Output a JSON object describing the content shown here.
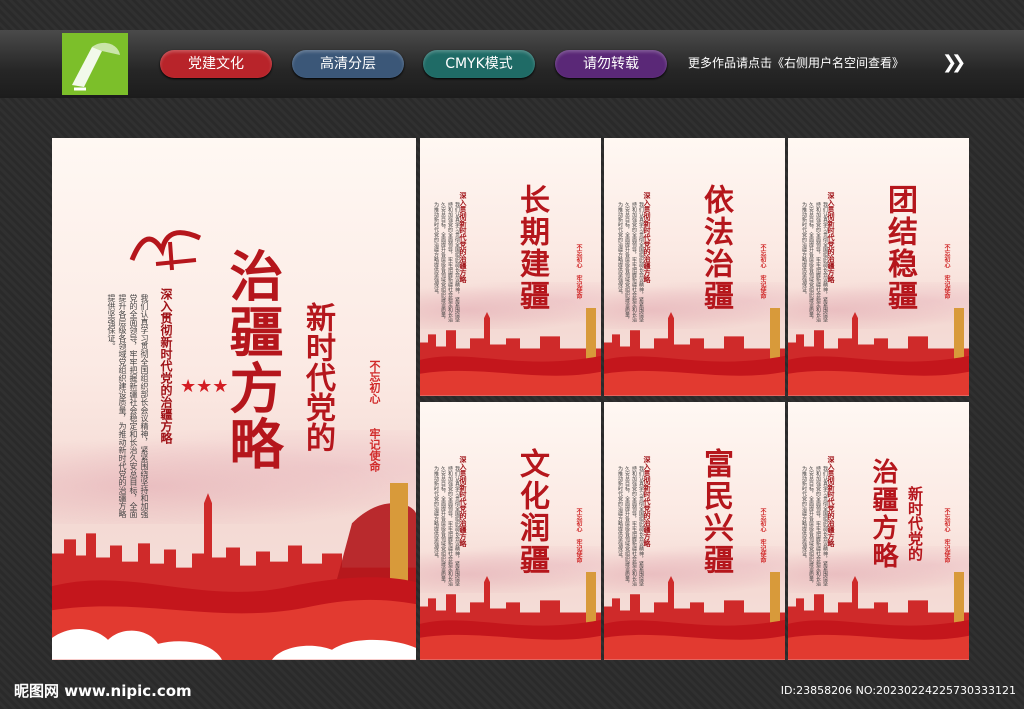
{
  "header": {
    "tags": [
      "党建文化",
      "高清分层",
      "CMYK模式",
      "请勿转载"
    ],
    "more_text": "更多作品请点击《右侧用户名空间查看》",
    "arrow_icon": "double-chevron-right-icon"
  },
  "main_poster": {
    "title": "治疆方略",
    "subtitle": "新时代党的",
    "lead": "深入贯彻新时代党的治疆方略",
    "body": "我们认真学习贯彻全国组织部长会议精神，紧紧围绕坚持和加强党的全面领导，牢牢把握新疆社会稳定和长治久安总目标，全面提升各层级各领域党组织建设质量，为推动新时代党的治疆方略提供坚强保证。",
    "slogan_a": "不忘初心",
    "slogan_b": "牢记使命",
    "stars": "★★★"
  },
  "posters": [
    {
      "title": "长期建疆",
      "lead": "深入贯彻新时代党的治疆方略"
    },
    {
      "title": "依法治疆",
      "lead": "深入贯彻新时代党的治疆方略"
    },
    {
      "title": "团结稳疆",
      "lead": "深入贯彻新时代党的治疆方略"
    },
    {
      "title": "文化润疆",
      "lead": "深入贯彻新时代党的治疆方略"
    },
    {
      "title": "富民兴疆",
      "lead": "深入贯彻新时代党的治疆方略"
    },
    {
      "title": "治疆方略",
      "subtitle": "新时代党的",
      "lead": "深入贯彻新时代党的治疆方略"
    }
  ],
  "small_slogan": "不忘初心 牢记使命",
  "footer": {
    "site": "昵图网 www.nipic.com",
    "id_text": "ID:23858206 NO:20230224225730333121"
  },
  "colors": {
    "accent_red": "#b5161c",
    "logo_green": "#7cbf2a"
  }
}
